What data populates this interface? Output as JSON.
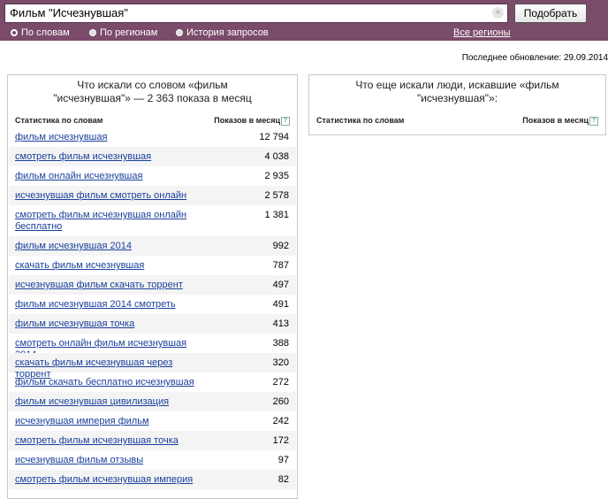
{
  "search": {
    "value": "Фильм \"Исчезнувшая\"",
    "clear_icon": "×",
    "button_label": "Подобрать"
  },
  "modes": [
    {
      "label": "По словам",
      "selected": true
    },
    {
      "label": "По регионам",
      "selected": false
    },
    {
      "label": "История запросов",
      "selected": false
    }
  ],
  "all_regions": "Все регионы",
  "updated": "Последнее обновление: 29.09.2014",
  "left_panel": {
    "title_line1": "Что искали со словом «фильм",
    "title_line2": "\"исчезнувшая\"» — 2 363 показа в месяц",
    "col_phrase": "Статистика по словам",
    "col_count": "Показов в месяц",
    "help": "?",
    "rows": [
      {
        "phrase": "фильм исчезнувшая",
        "count": "12 794"
      },
      {
        "phrase": "смотреть фильм исчезнувшая",
        "count": "4 038"
      },
      {
        "phrase": "фильм онлайн исчезнувшая",
        "count": "2 935"
      },
      {
        "phrase": "исчезнувшая фильм смотреть онлайн",
        "count": "2 578"
      },
      {
        "phrase": "смотреть фильм исчезнувшая онлайн бесплатно",
        "count": "1 381"
      },
      {
        "phrase": "фильм исчезнувшая 2014",
        "count": "992"
      },
      {
        "phrase": "скачать фильм исчезнувшая",
        "count": "787"
      },
      {
        "phrase": "исчезнувшая фильм скачать торрент",
        "count": "497"
      },
      {
        "phrase": "фильм исчезнувшая 2014 смотреть",
        "count": "491"
      },
      {
        "phrase": "фильм исчезнувшая точка",
        "count": "413"
      },
      {
        "phrase": "смотреть онлайн фильм исчезнувшая 2014",
        "count": "388"
      },
      {
        "phrase": "скачать фильм исчезнувшая через торрент",
        "count": "320"
      },
      {
        "phrase": "фильм скачать бесплатно исчезнувшая",
        "count": "272"
      },
      {
        "phrase": "фильм исчезнувшая цивилизация",
        "count": "260"
      },
      {
        "phrase": "исчезнувшая империя фильм",
        "count": "242"
      },
      {
        "phrase": "смотреть фильм исчезнувшая точка",
        "count": "172"
      },
      {
        "phrase": "исчезнувшая фильм отзывы",
        "count": "97"
      },
      {
        "phrase": "смотреть фильм исчезнувшая империя",
        "count": "82"
      }
    ]
  },
  "right_panel": {
    "title_line1": "Что еще искали люди, искавшие «фильм",
    "title_line2": "\"исчезнувшая\"»:",
    "col_phrase": "Статистика по словам",
    "col_count": "Показов в месяц",
    "help": "?"
  }
}
